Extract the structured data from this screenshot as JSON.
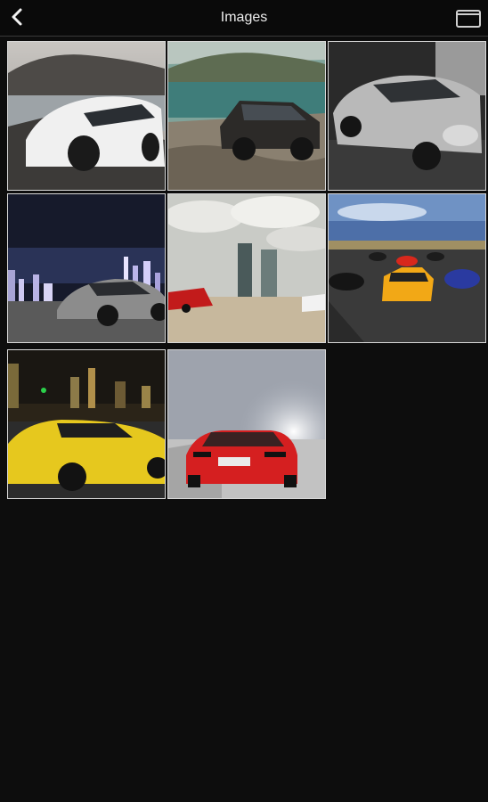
{
  "header": {
    "title": "Images",
    "back_icon": "chevron-left-icon",
    "window_icon": "window-icon"
  },
  "images": [
    {
      "name": "bugatti-white-coast"
    },
    {
      "name": "suv-cliff-sea"
    },
    {
      "name": "silver-sports-car-studio"
    },
    {
      "name": "grey-coupe-city-night"
    },
    {
      "name": "red-car-towers"
    },
    {
      "name": "supercar-race-runway"
    },
    {
      "name": "yellow-camaro-night-city"
    },
    {
      "name": "red-audi-road"
    }
  ]
}
